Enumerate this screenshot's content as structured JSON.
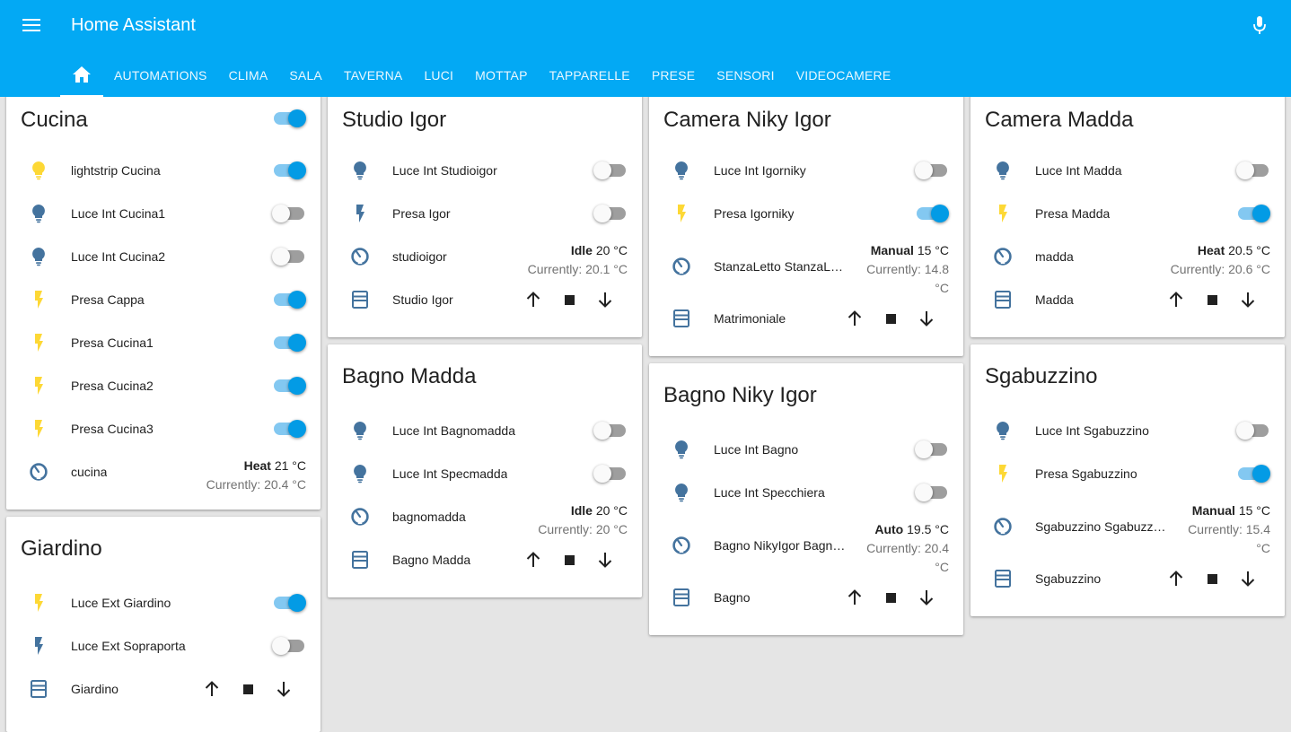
{
  "app": {
    "title": "Home Assistant"
  },
  "colors": {
    "header": "#03a9f4",
    "toggle_on": "#039be5",
    "icon_default": "#44739e",
    "icon_active": "#fdd835"
  },
  "tabs": [
    {
      "icon": "home-icon",
      "label": ""
    },
    {
      "label": "AUTOMATIONS"
    },
    {
      "label": "CLIMA"
    },
    {
      "label": "SALA"
    },
    {
      "label": "TAVERNA"
    },
    {
      "label": "LUCI"
    },
    {
      "label": "MOTTAP"
    },
    {
      "label": "TAPPARELLE"
    },
    {
      "label": "PRESE"
    },
    {
      "label": "SENSORI"
    },
    {
      "label": "VIDEOCAMERE"
    }
  ],
  "cards": {
    "cucina": {
      "title": "Cucina",
      "header_toggle": "on",
      "rows": [
        {
          "icon": "lightbulb-icon",
          "name": "lightstrip Cucina",
          "state": "on"
        },
        {
          "icon": "lightbulb-icon",
          "name": "Luce Int Cucina1",
          "state": "off"
        },
        {
          "icon": "lightbulb-icon",
          "name": "Luce Int Cucina2",
          "state": "off"
        },
        {
          "icon": "flash-icon",
          "name": "Presa Cappa",
          "state": "on"
        },
        {
          "icon": "flash-icon",
          "name": "Presa Cucina1",
          "state": "on"
        },
        {
          "icon": "flash-icon",
          "name": "Presa Cucina2",
          "state": "on"
        },
        {
          "icon": "flash-icon",
          "name": "Presa Cucina3",
          "state": "on"
        },
        {
          "icon": "thermostat-icon",
          "name": "cucina",
          "mode": "Heat",
          "target": "21 °C",
          "current": "Currently: 20.4 °C"
        }
      ]
    },
    "giardino": {
      "title": "Giardino",
      "rows": [
        {
          "icon": "flash-icon",
          "name": "Luce Ext Giardino",
          "state": "on"
        },
        {
          "icon": "flash-icon",
          "name": "Luce Ext Sopraporta",
          "state": "off"
        },
        {
          "icon": "window-shutter-icon",
          "name": "Giardino"
        }
      ]
    },
    "studio_igor": {
      "title": "Studio Igor",
      "rows": [
        {
          "icon": "lightbulb-icon",
          "name": "Luce Int Studioigor",
          "state": "off"
        },
        {
          "icon": "flash-icon",
          "name": "Presa Igor",
          "state": "off"
        },
        {
          "icon": "thermostat-icon",
          "name": "studioigor",
          "mode": "Idle",
          "target": "20 °C",
          "current": "Currently: 20.1 °C"
        },
        {
          "icon": "window-shutter-icon",
          "name": "Studio Igor"
        }
      ]
    },
    "bagno_madda": {
      "title": "Bagno Madda",
      "rows": [
        {
          "icon": "lightbulb-icon",
          "name": "Luce Int Bagnomadda",
          "state": "off"
        },
        {
          "icon": "lightbulb-icon",
          "name": "Luce Int Specmadda",
          "state": "off"
        },
        {
          "icon": "thermostat-icon",
          "name": "bagnomadda",
          "mode": "Idle",
          "target": "20 °C",
          "current": "Currently: 20 °C"
        },
        {
          "icon": "window-shutter-icon",
          "name": "Bagno Madda"
        }
      ]
    },
    "camera_niky_igor": {
      "title": "Camera Niky Igor",
      "rows": [
        {
          "icon": "lightbulb-icon",
          "name": "Luce Int Igorniky",
          "state": "off"
        },
        {
          "icon": "flash-icon",
          "name": "Presa Igorniky",
          "state": "on"
        },
        {
          "icon": "thermostat-icon",
          "name": "StanzaLetto StanzaLetto",
          "mode": "Manual",
          "target": "15 °C",
          "current": "Currently: 14.8",
          "current_unit": "°C"
        },
        {
          "icon": "window-shutter-icon",
          "name": "Matrimoniale"
        }
      ]
    },
    "bagno_niky_igor": {
      "title": "Bagno Niky Igor",
      "rows": [
        {
          "icon": "lightbulb-icon",
          "name": "Luce Int Bagno",
          "state": "off"
        },
        {
          "icon": "lightbulb-icon",
          "name": "Luce Int Specchiera",
          "state": "off"
        },
        {
          "icon": "thermostat-icon",
          "name": "Bagno NikyIgor Bagno NikyIgor",
          "mode": "Auto",
          "target": "19.5 °C",
          "current": "Currently: 20.4",
          "current_unit": "°C"
        },
        {
          "icon": "window-shutter-icon",
          "name": "Bagno"
        }
      ]
    },
    "camera_madda": {
      "title": "Camera Madda",
      "rows": [
        {
          "icon": "lightbulb-icon",
          "name": "Luce Int Madda",
          "state": "off"
        },
        {
          "icon": "flash-icon",
          "name": "Presa Madda",
          "state": "on"
        },
        {
          "icon": "thermostat-icon",
          "name": "madda",
          "mode": "Heat",
          "target": "20.5 °C",
          "current": "Currently: 20.6 °C"
        },
        {
          "icon": "window-shutter-icon",
          "name": "Madda"
        }
      ]
    },
    "sgabuzzino": {
      "title": "Sgabuzzino",
      "rows": [
        {
          "icon": "lightbulb-icon",
          "name": "Luce Int Sgabuzzino",
          "state": "off"
        },
        {
          "icon": "flash-icon",
          "name": "Presa Sgabuzzino",
          "state": "on"
        },
        {
          "icon": "thermostat-icon",
          "name": "Sgabuzzino Sgabuzzino",
          "mode": "Manual",
          "target": "15 °C",
          "current": "Currently: 15.4",
          "current_unit": "°C"
        },
        {
          "icon": "window-shutter-icon",
          "name": "Sgabuzzino"
        }
      ]
    }
  }
}
